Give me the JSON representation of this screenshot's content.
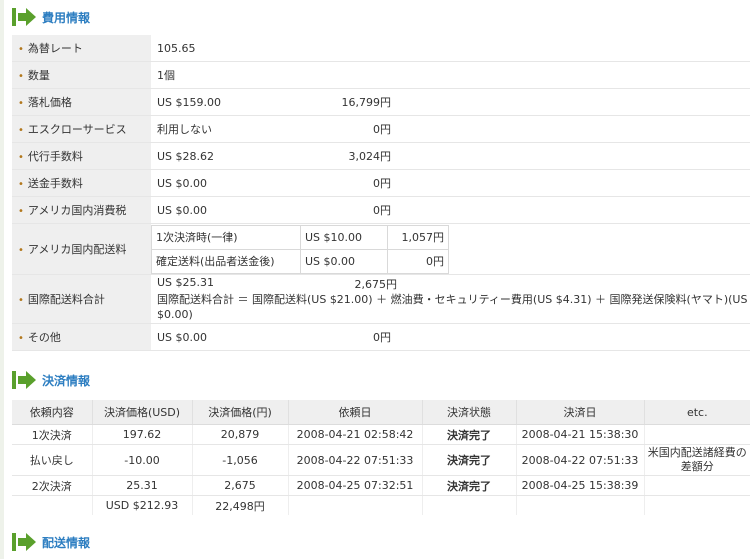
{
  "sections": {
    "fees": "費用情報",
    "payment": "決済情報",
    "shipping": "配送情報"
  },
  "fees": [
    {
      "label": "為替レート",
      "usd": "105.65",
      "jpy": ""
    },
    {
      "label": "数量",
      "usd": "1個",
      "jpy": ""
    },
    {
      "label": "落札価格",
      "usd": "US $159.00",
      "jpy": "16,799円"
    },
    {
      "label": "エスクローサービス",
      "usd": "利用しない",
      "jpy": "0円"
    },
    {
      "label": "代行手数料",
      "usd": "US $28.62",
      "jpy": "3,024円"
    },
    {
      "label": "送金手数料",
      "usd": "US $0.00",
      "jpy": "0円"
    },
    {
      "label": "アメリカ国内消費税",
      "usd": "US $0.00",
      "jpy": "0円"
    }
  ],
  "domestic_shipping": {
    "label": "アメリカ国内配送料",
    "rows": [
      {
        "name": "1次決済時(一律)",
        "usd": "US $10.00",
        "jpy": "1,057円"
      },
      {
        "name": "確定送料(出品者送金後)",
        "usd": "US $0.00",
        "jpy": "0円"
      }
    ]
  },
  "intl_shipping": {
    "label": "国際配送料合計",
    "usd": "US $25.31",
    "jpy": "2,675円",
    "note": "国際配送料合計 ＝ 国際配送料(US $21.00) ＋ 燃油費・セキュリティー費用(US $4.31) ＋ 国際発送保険料(ヤマト)(US $0.00)"
  },
  "other": {
    "label": "その他",
    "usd": "US $0.00",
    "jpy": "0円"
  },
  "payment": {
    "headers": [
      "依頼内容",
      "決済価格(USD)",
      "決済価格(円)",
      "依頼日",
      "決済状態",
      "決済日",
      "etc."
    ],
    "rows": [
      [
        "1次決済",
        "197.62",
        "20,879",
        "2008-04-21 02:58:42",
        "決済完了",
        "2008-04-21 15:38:30",
        ""
      ],
      [
        "払い戻し",
        "-10.00",
        "-1,056",
        "2008-04-22 07:51:33",
        "決済完了",
        "2008-04-22 07:51:33",
        "米国内配送諸経費の差額分"
      ],
      [
        "2次決済",
        "25.31",
        "2,675",
        "2008-04-25 07:32:51",
        "決済完了",
        "2008-04-25 15:38:39",
        ""
      ]
    ],
    "total_usd": "USD $212.93",
    "total_jpy": "22,498円"
  },
  "colors": {
    "accent": "#2d7ec1",
    "arrow": "#5aa02c",
    "label_bg": "#efefef",
    "bullet": "#b2781d"
  }
}
